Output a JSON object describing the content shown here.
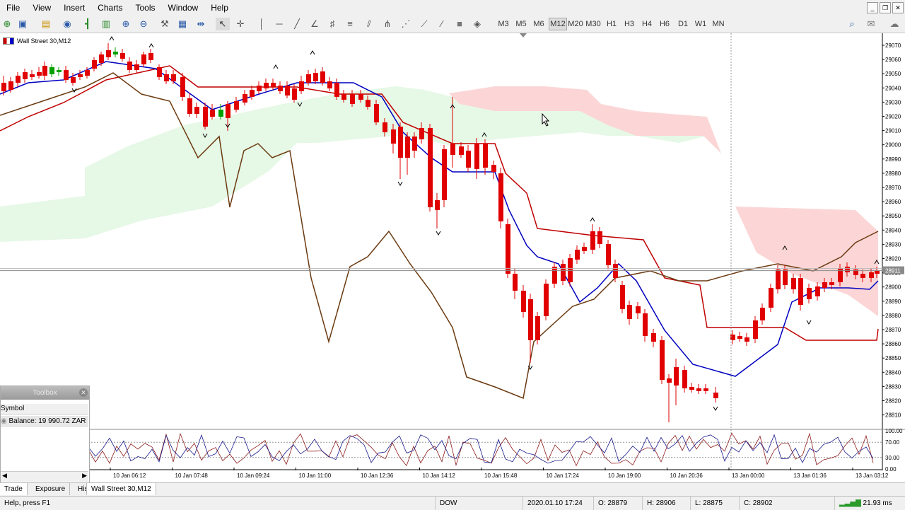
{
  "menu": [
    "File",
    "View",
    "Insert",
    "Charts",
    "Tools",
    "Window",
    "Help"
  ],
  "timeframes": [
    "M3",
    "M5",
    "M6",
    "M12",
    "M20",
    "M30",
    "H1",
    "H3",
    "H4",
    "H6",
    "D1",
    "W1",
    "MN"
  ],
  "active_timeframe": "M12",
  "chart_title": "Wall Street 30,M12",
  "price_axis": {
    "ticks": [
      "29070",
      "29060",
      "29050",
      "29040",
      "29030",
      "29020",
      "29010",
      "29000",
      "28990",
      "28980",
      "28970",
      "28960",
      "28950",
      "28940",
      "28930",
      "28920",
      "28910",
      "28900",
      "28890",
      "28880",
      "28870",
      "28860",
      "28850",
      "28840",
      "28830",
      "28820",
      "28810"
    ],
    "current_price": "28911"
  },
  "indicator_axis": [
    "100.00",
    "70.00",
    "30.00",
    "0.00"
  ],
  "time_axis": [
    "10 Jan 06:12",
    "10 Jan 07:48",
    "10 Jan 09:24",
    "10 Jan 11:00",
    "10 Jan 12:36",
    "10 Jan 14:12",
    "10 Jan 15:48",
    "10 Jan 17:24",
    "10 Jan 19:00",
    "10 Jan 20:36",
    "13 Jan 00:00",
    "13 Jan 01:36",
    "13 Jan 03:12"
  ],
  "toolbox": {
    "title": "Toolbox",
    "column": "Symbol",
    "balance": "Balance: 19 990.72 ZAR"
  },
  "tabs": [
    "Trade",
    "Exposure",
    "His"
  ],
  "chart_tab": "Wall Street 30,M12",
  "status": {
    "help": "Help, press F1",
    "profile": "DOW",
    "datetime": "2020.01.10 17:24",
    "open": "O: 28879",
    "high": "H: 28906",
    "low": "L: 28875",
    "close": "C: 28902",
    "ping": "21.93 ms"
  },
  "colors": {
    "bull": "#00a000",
    "bear": "#e00000",
    "tenkan": "#0000c0",
    "kijun": "#c00000",
    "chikou": "#6b3a10",
    "cloud_bull": "#e6f8e6",
    "cloud_bear": "#fcd6d6"
  }
}
